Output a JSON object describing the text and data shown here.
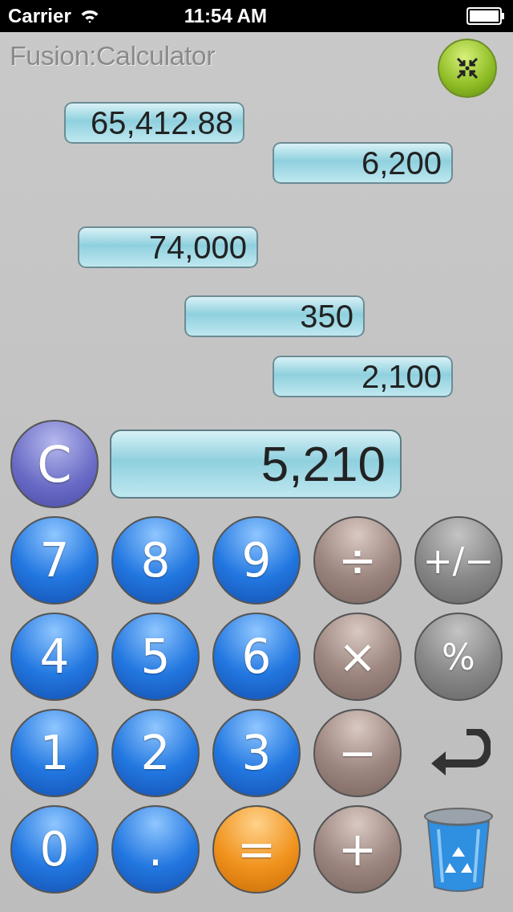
{
  "status_bar": {
    "carrier": "Carrier",
    "time": "11:54 AM"
  },
  "app_title": "Fusion:Calculator",
  "tiles": [
    {
      "value": "65,412.88"
    },
    {
      "value": "6,200"
    },
    {
      "value": "74,000"
    },
    {
      "value": "350"
    },
    {
      "value": "2,100"
    }
  ],
  "clear_button": {
    "label": "C"
  },
  "display": {
    "value": "5,210"
  },
  "keys": [
    {
      "kind": "digit",
      "label": "7"
    },
    {
      "kind": "digit",
      "label": "8"
    },
    {
      "kind": "digit",
      "label": "9"
    },
    {
      "kind": "operator",
      "label": "÷"
    },
    {
      "kind": "function",
      "label": "+/−"
    },
    {
      "kind": "digit",
      "label": "4"
    },
    {
      "kind": "digit",
      "label": "5"
    },
    {
      "kind": "digit",
      "label": "6"
    },
    {
      "kind": "operator",
      "label": "×"
    },
    {
      "kind": "function",
      "label": "%"
    },
    {
      "kind": "digit",
      "label": "1"
    },
    {
      "kind": "digit",
      "label": "2"
    },
    {
      "kind": "digit",
      "label": "3"
    },
    {
      "kind": "operator",
      "label": "−"
    },
    {
      "kind": "enter"
    },
    {
      "kind": "digit",
      "label": "0"
    },
    {
      "kind": "digit",
      "label": "."
    },
    {
      "kind": "equals",
      "label": "="
    },
    {
      "kind": "operator",
      "label": "+"
    },
    {
      "kind": "trash"
    }
  ]
}
